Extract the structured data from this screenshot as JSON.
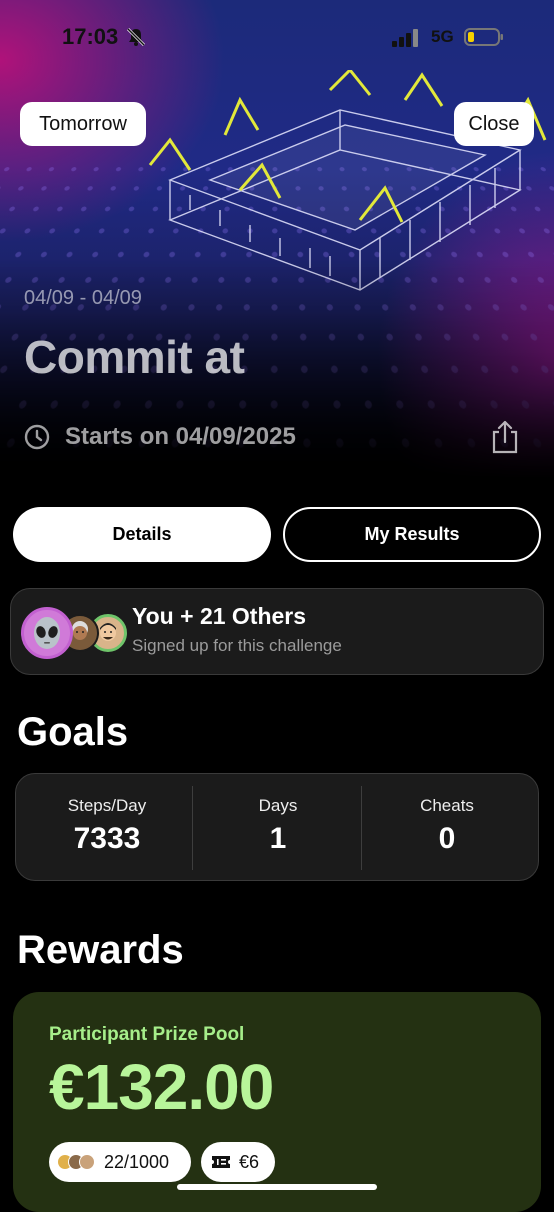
{
  "status_bar": {
    "time": "17:03",
    "network": "5G",
    "battery_color": "#f5d000"
  },
  "header": {
    "left_button": "Tomorrow",
    "right_button": "Close"
  },
  "challenge": {
    "date_range": "04/09 - 04/09",
    "title": "Commit at",
    "starts_on": "Starts on 04/09/2025"
  },
  "tabs": [
    {
      "label": "Details",
      "selected": true
    },
    {
      "label": "My Results",
      "selected": false
    }
  ],
  "participants": {
    "title": "You + 21 Others",
    "subtitle": "Signed up for this challenge",
    "avatars": [
      "alien-avatar",
      "person-avatar",
      "person-avatar"
    ]
  },
  "goals": {
    "heading": "Goals",
    "items": [
      {
        "label": "Steps/Day",
        "value": "7333"
      },
      {
        "label": "Days",
        "value": "1"
      },
      {
        "label": "Cheats",
        "value": "0"
      }
    ]
  },
  "rewards": {
    "heading": "Rewards",
    "pool_label": "Participant Prize Pool",
    "pool_value": "€132.00",
    "participants_count": "22/1000",
    "entry_fee": "€6",
    "accent": "#b8f59a",
    "card_color": "#243112"
  }
}
